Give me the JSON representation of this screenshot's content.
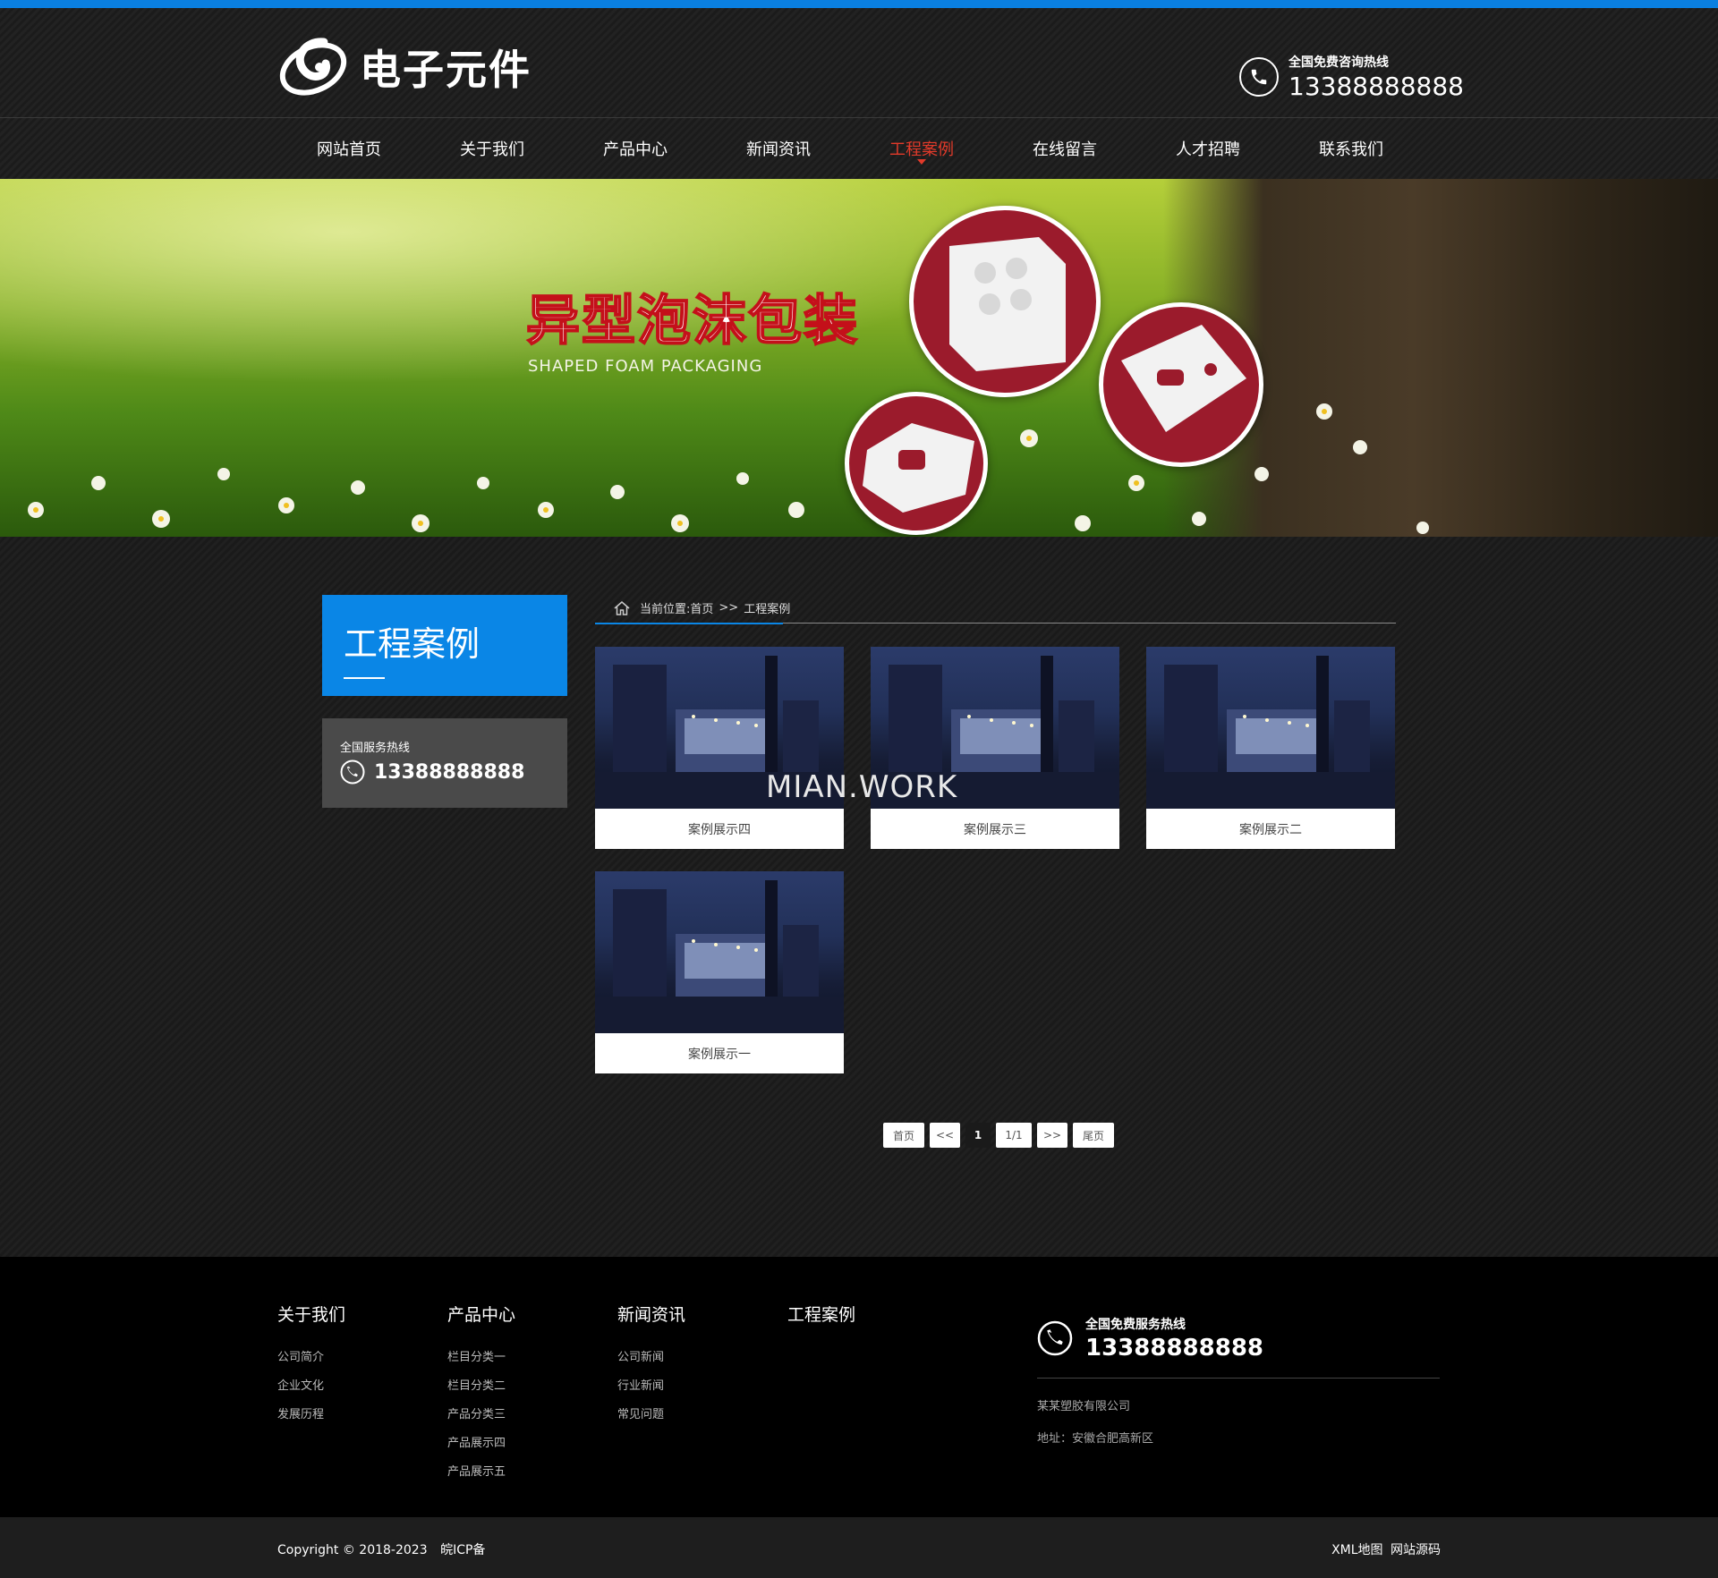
{
  "header": {
    "logo_text": "电子元件",
    "hotline_label": "全国免费咨询热线",
    "hotline_number": "13388888888"
  },
  "nav": {
    "items": [
      {
        "label": "网站首页"
      },
      {
        "label": "关于我们"
      },
      {
        "label": "产品中心"
      },
      {
        "label": "新闻资讯"
      },
      {
        "label": "工程案例",
        "active": true
      },
      {
        "label": "在线留言"
      },
      {
        "label": "人才招聘"
      },
      {
        "label": "联系我们"
      }
    ]
  },
  "banner": {
    "title": "异型泡沫包装",
    "subtitle": "SHAPED FOAM PACKAGING"
  },
  "sidebar": {
    "title": "工程案例",
    "contact_label": "全国服务热线",
    "contact_number": "13388888888"
  },
  "breadcrumb": {
    "prefix": "当前位置:",
    "home": "首页",
    "separator": ">>",
    "current": "工程案例"
  },
  "cases": [
    {
      "title": "案例展示四"
    },
    {
      "title": "案例展示三"
    },
    {
      "title": "案例展示二"
    },
    {
      "title": "案例展示一"
    }
  ],
  "watermark": "MIAN.WORK",
  "pagination": {
    "first": "首页",
    "prev": "<<",
    "current": "1",
    "info": "1/1",
    "next": ">>",
    "last": "尾页"
  },
  "footer": {
    "columns": [
      {
        "title": "关于我们",
        "links": [
          "公司简介",
          "企业文化",
          "发展历程"
        ]
      },
      {
        "title": "产品中心",
        "links": [
          "栏目分类一",
          "栏目分类二",
          "产品分类三",
          "产品展示四",
          "产品展示五"
        ]
      },
      {
        "title": "新闻资讯",
        "links": [
          "公司新闻",
          "行业新闻",
          "常见问题"
        ]
      },
      {
        "title": "工程案例",
        "links": []
      }
    ],
    "contact_label": "全国免费服务热线",
    "contact_number": "13388888888",
    "company": "某某塑胶有限公司",
    "address": "地址：安徽合肥高新区"
  },
  "copyright": {
    "text": "Copyright © 2018-2023",
    "icp": "皖ICP备",
    "xml_map": "XML地图",
    "source": "网站源码"
  },
  "colors": {
    "accent_blue": "#0a86e6",
    "active_red": "#e23a2a",
    "banner_circle_red": "#9b1b2c"
  }
}
